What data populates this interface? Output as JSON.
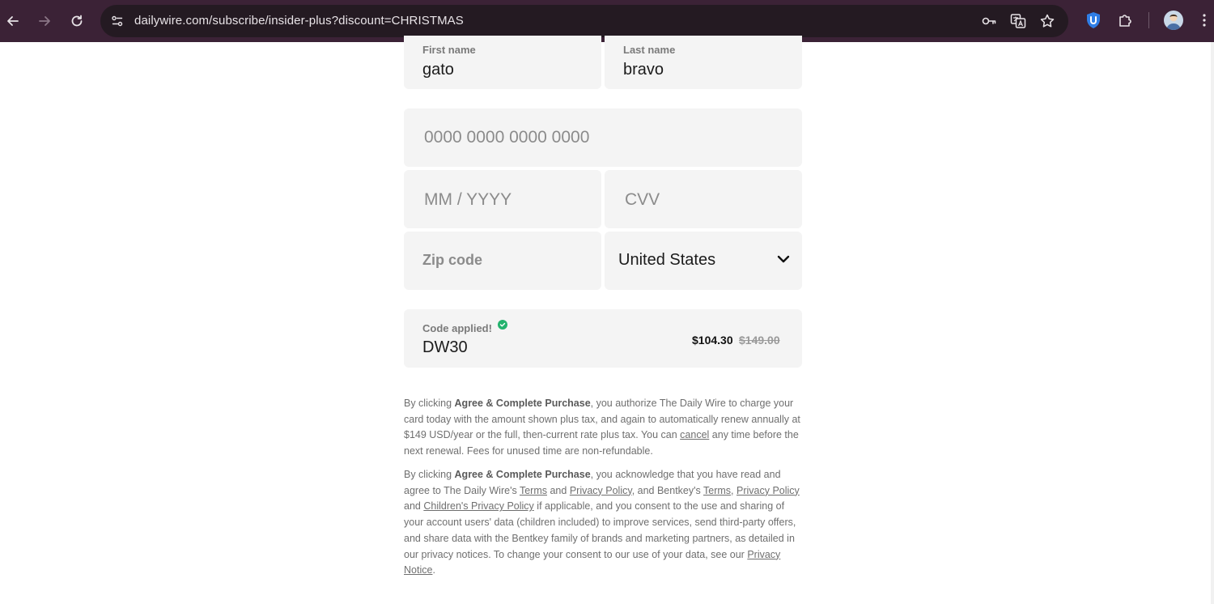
{
  "browser": {
    "url": "dailywire.com/subscribe/insider-plus?discount=CHRISTMAS"
  },
  "form": {
    "first_name": {
      "label": "First name",
      "value": "gato"
    },
    "last_name": {
      "label": "Last name",
      "value": "bravo"
    },
    "card_number": {
      "placeholder": "0000 0000 0000 0000"
    },
    "expiry": {
      "placeholder": "MM / YYYY"
    },
    "cvv": {
      "placeholder": "CVV"
    },
    "zip": {
      "placeholder": "Zip code"
    },
    "country": {
      "selected": "United States"
    },
    "promo": {
      "label": "Code applied!",
      "code": "DW30",
      "price_new": "$104.30",
      "price_old": "$149.00"
    }
  },
  "legal1": {
    "t1": "By clicking ",
    "b1": "Agree & Complete Purchase",
    "t2": ", you authorize The Daily Wire to charge your card today with the amount shown plus tax, and again to automatically renew annually at $149 USD/year or the full, then-current rate plus tax. You can ",
    "cancel_link": "cancel",
    "t3": " any time before the next renewal. Fees for unused time are non-refundable."
  },
  "legal2": {
    "t1": "By clicking ",
    "b1": "Agree & Complete Purchase",
    "t2": ", you acknowledge that you have read and agree to The Daily Wire's ",
    "terms_link": "Terms",
    "t3": " and ",
    "privacy_link": "Privacy Policy",
    "t4": ", and Bentkey's ",
    "bentkey_terms_link": "Terms",
    "t5": ", ",
    "bentkey_privacy_link": "Privacy Policy ",
    "t6": "and ",
    "children_link": "Children's Privacy Policy",
    "t7": " if applicable, and you consent to the use and sharing of your account users' data (children included) to improve services, send third-party offers, and share data with the Bentkey family of brands and marketing partners, as detailed in our privacy notices. To change your consent to our use of your data, see our ",
    "notice_link": "Privacy Notice",
    "t8": "."
  },
  "colors": {
    "chrome_bg": "#3b2236",
    "field_bg": "#f4f4f4",
    "success": "#23b26d"
  }
}
